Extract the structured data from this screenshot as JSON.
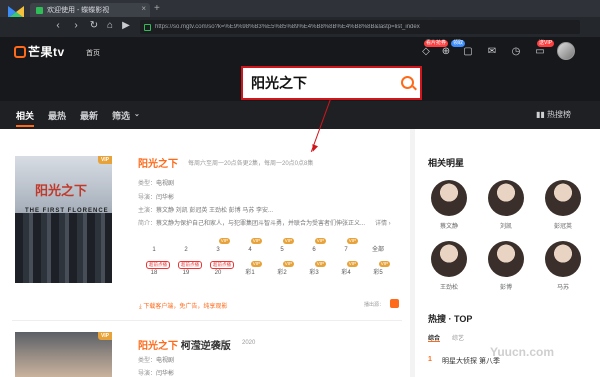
{
  "browser": {
    "tab_title": "欢迎使用 - 蝶蝶影视",
    "url": "https://so.mgtv.com/so?k=%E9%98%B3%E5%85%89%E4%B8%8B%E4%B8%8B&lastp=list_index"
  },
  "header": {
    "logo_text": "芒果tv",
    "nav_home": "首页",
    "search_value": "阳光之下",
    "badge_red": "看片抢券",
    "badge_blue": "领取",
    "vip_label": "送VIP"
  },
  "filters": {
    "tabs": [
      "相关",
      "最热",
      "最新",
      "筛选"
    ],
    "hot_search": "热搜榜"
  },
  "result1": {
    "vip": "VIP",
    "poster_title": "阳光之下",
    "poster_subtitle": "THE FIRST FLORENCE",
    "title": "阳光之下",
    "update": "每周六至周一20点各更2集，每周一20点0点8集",
    "type_label": "类型：",
    "type_value": "电视剧",
    "director_label": "导演：",
    "director_value": "闫华彬",
    "cast_label": "主演：",
    "cast_value": "蔡文静  刘凯  彭冠英  王劲松  彭博  马苏  李安...",
    "plot_label": "简介：",
    "plot_value": "蔡文静为保护自己和家人，与犯罪集团斗智斗勇，并联合为受害者们伸张正义...",
    "plot_more": "详情 ›",
    "episodes": [
      {
        "label": "1",
        "tag": ""
      },
      {
        "label": "2",
        "tag": ""
      },
      {
        "label": "3",
        "tag": "VIP"
      },
      {
        "label": "4",
        "tag": "VIP"
      },
      {
        "label": "5",
        "tag": "VIP"
      },
      {
        "label": "6",
        "tag": "VIP"
      },
      {
        "label": "7",
        "tag": "VIP"
      },
      {
        "label": "全部",
        "tag": ""
      },
      {
        "label": "18",
        "tag": "超前点播"
      },
      {
        "label": "19",
        "tag": "超前点播"
      },
      {
        "label": "20",
        "tag": "超前点播"
      },
      {
        "label": "彩1",
        "tag": "VIP"
      },
      {
        "label": "彩2",
        "tag": "VIP"
      },
      {
        "label": "彩3",
        "tag": "VIP"
      },
      {
        "label": "彩4",
        "tag": "VIP"
      },
      {
        "label": "彩5",
        "tag": "VIP"
      }
    ],
    "download_text": "下载客户端，免广告，纯享观影",
    "playback_text": "播出源："
  },
  "result2": {
    "title_main": "阳光之下",
    "title_rest": " 柯滢逆袭版",
    "year": "2020",
    "type_label": "类型：",
    "type_value": "电视剧",
    "director_label": "导演：",
    "director_value": "闫华彬"
  },
  "sidebar": {
    "related_heading": "相关明星",
    "stars": [
      "蔡文静",
      "刘凯",
      "彭冠英",
      "王劲松",
      "彭博",
      "马苏"
    ],
    "top_heading": "热搜 · TOP",
    "top_tabs": [
      "综合",
      "综艺"
    ],
    "rank_number": "1",
    "rank_title": "明星大侦探 第八季"
  },
  "watermark": "Yuucn.com"
}
